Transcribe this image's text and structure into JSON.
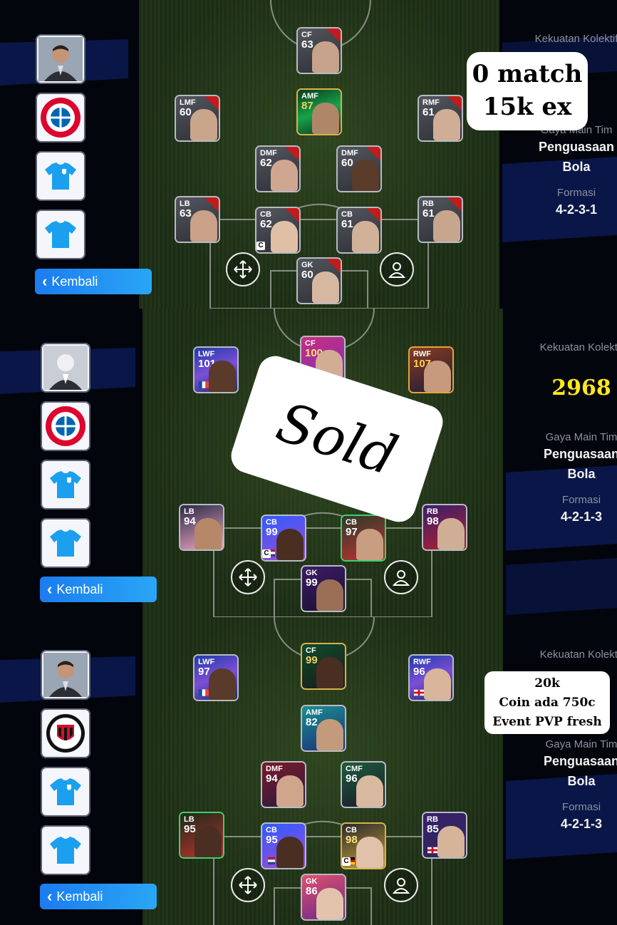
{
  "panels": [
    {
      "kembali": "Kembali",
      "club": "FC Bayern München",
      "info": {
        "power_label": "Kekuatan Kolektif",
        "power_value": "",
        "style_label": "Gaya Main Tim",
        "style_value_1": "Penguasaan",
        "style_value_2": "Bola",
        "formation_label": "Formasi",
        "formation_value": "4-2-3-1"
      },
      "players": [
        {
          "pos": "CF",
          "rating": "63"
        },
        {
          "pos": "LMF",
          "rating": "60"
        },
        {
          "pos": "AMF",
          "rating": "87"
        },
        {
          "pos": "RMF",
          "rating": "61"
        },
        {
          "pos": "DMF",
          "rating": "62"
        },
        {
          "pos": "DMF",
          "rating": "60"
        },
        {
          "pos": "LB",
          "rating": "63"
        },
        {
          "pos": "CB",
          "rating": "62"
        },
        {
          "pos": "CB",
          "rating": "61"
        },
        {
          "pos": "RB",
          "rating": "61"
        },
        {
          "pos": "GK",
          "rating": "60"
        }
      ],
      "captain": "C",
      "note": {
        "line1": "0 match",
        "line2": "15k ex"
      }
    },
    {
      "kembali": "Kembali",
      "club": "FC Bayern München",
      "info": {
        "power_label": "Kekuatan Kolektif",
        "power_value": "2968",
        "style_label": "Gaya Main Tim",
        "style_value_1": "Penguasaan",
        "style_value_2": "Bola",
        "formation_label": "Formasi",
        "formation_value": "4-2-1-3"
      },
      "players": [
        {
          "pos": "LWF",
          "rating": "101"
        },
        {
          "pos": "CF",
          "rating": "100"
        },
        {
          "pos": "RWF",
          "rating": "107"
        },
        {
          "pos": "LB",
          "rating": "94"
        },
        {
          "pos": "CB",
          "rating": "99"
        },
        {
          "pos": "CB",
          "rating": "97"
        },
        {
          "pos": "RB",
          "rating": "98"
        },
        {
          "pos": "GK",
          "rating": "99"
        }
      ],
      "captain": "C",
      "note": {
        "text": "Sold"
      }
    },
    {
      "kembali": "Kembali",
      "club": "AC Milan 1899",
      "info": {
        "power_label": "Kekuatan Kolektif",
        "power_value": "",
        "style_label": "Gaya Main Tim",
        "style_value_1": "Penguasaan",
        "style_value_2": "Bola",
        "formation_label": "Formasi",
        "formation_value": "4-2-1-3"
      },
      "players": [
        {
          "pos": "LWF",
          "rating": "97"
        },
        {
          "pos": "CF",
          "rating": "99"
        },
        {
          "pos": "RWF",
          "rating": "96"
        },
        {
          "pos": "AMF",
          "rating": "82"
        },
        {
          "pos": "DMF",
          "rating": "94"
        },
        {
          "pos": "CMF",
          "rating": "96"
        },
        {
          "pos": "LB",
          "rating": "95"
        },
        {
          "pos": "CB",
          "rating": "95"
        },
        {
          "pos": "CB",
          "rating": "98"
        },
        {
          "pos": "RB",
          "rating": "85"
        },
        {
          "pos": "GK",
          "rating": "86"
        }
      ],
      "captain": "C",
      "note": {
        "line1": "20k",
        "line2": "Coin ada 750c",
        "line3": "Event PVP fresh"
      }
    }
  ],
  "colors": {
    "kembali_bg": "#1b7cf0",
    "power": "#ffe81a",
    "base_card": "#45474e",
    "accent_red": "#c31b1b"
  },
  "icons": [
    "manager-avatar-icon",
    "club-badge-icon",
    "home-kit-icon",
    "away-kit-icon",
    "move-icon",
    "player-icon",
    "chevron-left-icon"
  ]
}
